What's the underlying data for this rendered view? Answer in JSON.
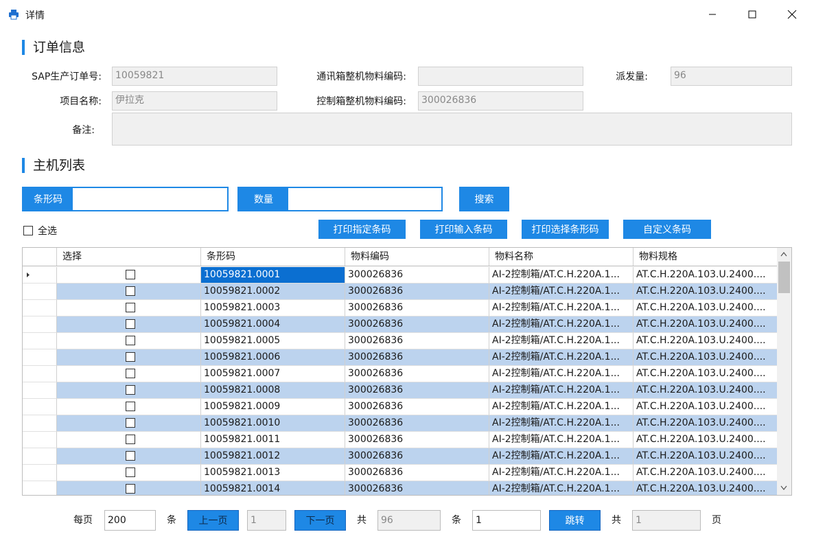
{
  "window": {
    "title": "详情"
  },
  "order": {
    "section_title": "订单信息",
    "sap_label": "SAP生产订单号:",
    "sap_value": "10059821",
    "comm_label": "通讯箱整机物料编码:",
    "comm_value": "",
    "dispatch_label": "派发量:",
    "dispatch_value": "96",
    "project_label": "项目名称:",
    "project_value": "伊拉克",
    "ctrl_label": "控制箱整机物料编码:",
    "ctrl_value": "300026836",
    "remark_label": "备注:",
    "remark_value": ""
  },
  "host": {
    "section_title": "主机列表",
    "barcode_tag": "条形码",
    "barcode_value": "",
    "qty_tag": "数量",
    "qty_value": "",
    "search_label": "搜索",
    "select_all_label": "全选",
    "btn_print_specified": "打印指定条码",
    "btn_print_input": "打印输入条码",
    "btn_print_selected": "打印选择条形码",
    "btn_custom": "自定义条码"
  },
  "grid": {
    "columns": [
      "选择",
      "条形码",
      "物料编码",
      "物料名称",
      "物料规格"
    ],
    "rows": [
      {
        "barcode": "10059821.0001",
        "material_code": "300026836",
        "material_name": "AI-2控制箱/AT.C.H.220A.1...",
        "material_spec": "AT.C.H.220A.103.U.2400...."
      },
      {
        "barcode": "10059821.0002",
        "material_code": "300026836",
        "material_name": "AI-2控制箱/AT.C.H.220A.1...",
        "material_spec": "AT.C.H.220A.103.U.2400...."
      },
      {
        "barcode": "10059821.0003",
        "material_code": "300026836",
        "material_name": "AI-2控制箱/AT.C.H.220A.1...",
        "material_spec": "AT.C.H.220A.103.U.2400...."
      },
      {
        "barcode": "10059821.0004",
        "material_code": "300026836",
        "material_name": "AI-2控制箱/AT.C.H.220A.1...",
        "material_spec": "AT.C.H.220A.103.U.2400...."
      },
      {
        "barcode": "10059821.0005",
        "material_code": "300026836",
        "material_name": "AI-2控制箱/AT.C.H.220A.1...",
        "material_spec": "AT.C.H.220A.103.U.2400...."
      },
      {
        "barcode": "10059821.0006",
        "material_code": "300026836",
        "material_name": "AI-2控制箱/AT.C.H.220A.1...",
        "material_spec": "AT.C.H.220A.103.U.2400...."
      },
      {
        "barcode": "10059821.0007",
        "material_code": "300026836",
        "material_name": "AI-2控制箱/AT.C.H.220A.1...",
        "material_spec": "AT.C.H.220A.103.U.2400...."
      },
      {
        "barcode": "10059821.0008",
        "material_code": "300026836",
        "material_name": "AI-2控制箱/AT.C.H.220A.1...",
        "material_spec": "AT.C.H.220A.103.U.2400...."
      },
      {
        "barcode": "10059821.0009",
        "material_code": "300026836",
        "material_name": "AI-2控制箱/AT.C.H.220A.1...",
        "material_spec": "AT.C.H.220A.103.U.2400...."
      },
      {
        "barcode": "10059821.0010",
        "material_code": "300026836",
        "material_name": "AI-2控制箱/AT.C.H.220A.1...",
        "material_spec": "AT.C.H.220A.103.U.2400...."
      },
      {
        "barcode": "10059821.0011",
        "material_code": "300026836",
        "material_name": "AI-2控制箱/AT.C.H.220A.1...",
        "material_spec": "AT.C.H.220A.103.U.2400...."
      },
      {
        "barcode": "10059821.0012",
        "material_code": "300026836",
        "material_name": "AI-2控制箱/AT.C.H.220A.1...",
        "material_spec": "AT.C.H.220A.103.U.2400...."
      },
      {
        "barcode": "10059821.0013",
        "material_code": "300026836",
        "material_name": "AI-2控制箱/AT.C.H.220A.1...",
        "material_spec": "AT.C.H.220A.103.U.2400...."
      },
      {
        "barcode": "10059821.0014",
        "material_code": "300026836",
        "material_name": "AI-2控制箱/AT.C.H.220A.1...",
        "material_spec": "AT.C.H.220A.103.U.2400...."
      }
    ]
  },
  "pager": {
    "per_page_label": "每页",
    "per_page_value": "200",
    "unit_label": "条",
    "prev_label": "上一页",
    "current_page": "1",
    "next_label": "下一页",
    "total_label": "共",
    "total_count": "96",
    "unit_label2": "条",
    "jump_value": "1",
    "jump_label": "跳转",
    "total_label2": "共",
    "total_pages": "1",
    "page_unit": "页"
  },
  "colors": {
    "accent": "#1e88e5",
    "row_alt": "#bcd3ee",
    "selected_cell": "#0b6fd1"
  }
}
